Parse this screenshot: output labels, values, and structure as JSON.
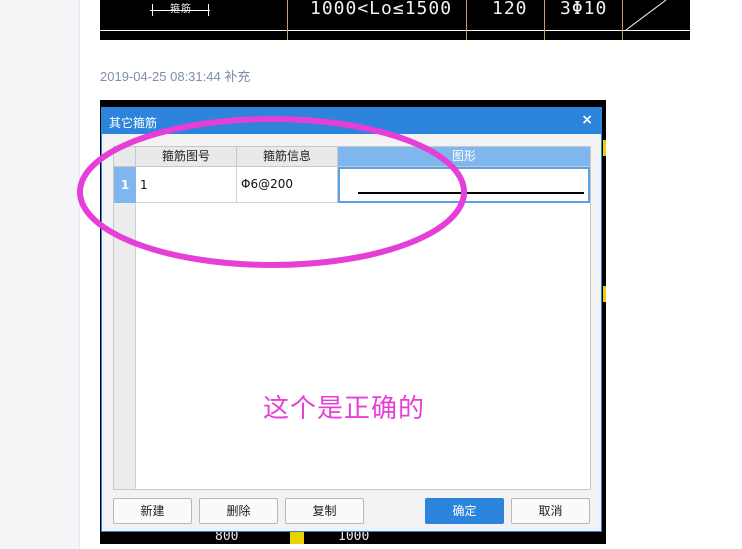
{
  "post": {
    "timestamp": "2019-04-25 08:31:44 补充"
  },
  "cad_top": {
    "label_a": "箍筋",
    "label_b": "1000<Lo≤1500",
    "label_c": "120",
    "label_d": "3Φ10"
  },
  "dialog": {
    "title": "其它箍筋",
    "close_glyph": "×",
    "columns": [
      "箍筋图号",
      "箍筋信息",
      "图形"
    ],
    "rows": [
      {
        "num": "1",
        "figure_no": "1",
        "info": "Φ6@200"
      }
    ],
    "shape_mark": "L",
    "buttons": {
      "new": "新建",
      "delete": "删除",
      "copy": "复制",
      "ok": "确定",
      "cancel": "取消"
    }
  },
  "annotation": {
    "text": "这个是正确的",
    "color": "#e63fd8"
  },
  "cad_bottom": {
    "left": "800",
    "right": "1000"
  },
  "colors": {
    "accent": "#2c84dd",
    "header_active": "#7fb6ee",
    "annotation": "#e63fd8"
  }
}
